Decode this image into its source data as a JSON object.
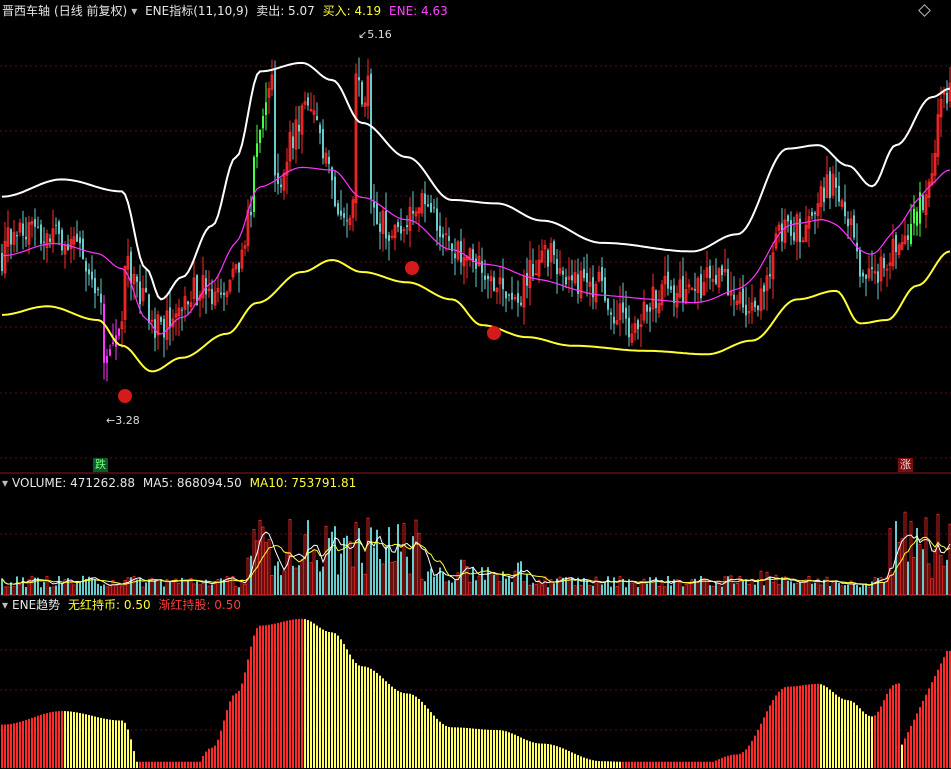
{
  "header_main": {
    "stock": "晋西车轴",
    "period": "(日线 前复权)",
    "indicator": "ENE指标(11,10,9)",
    "sell_label": "卖出: 5.07",
    "buy_label": "买入: 4.19",
    "ene_label": "ENE: 4.63"
  },
  "header_volume": {
    "volume_label": "VOLUME: 471262.88",
    "ma5_label": "MA5: 868094.50",
    "ma10_label": "MA10: 753791.81"
  },
  "header_trend": {
    "name": "ENE趋势",
    "no_red_label": "无红持币: 0.50",
    "red_label": "渐红持股: 0.50"
  },
  "annotations": {
    "high": "5.16",
    "low": "3.28",
    "down_mark": "跌",
    "up_mark": "涨"
  },
  "colors": {
    "upper": "#ffffff",
    "lower": "#ffff33",
    "mid": "#ff33ff",
    "up": "#ff2a2a",
    "down": "#66cccc",
    "green": "#44ff44"
  },
  "chart_data": {
    "type": "candlestick",
    "price_ylim": [
      2.9,
      5.35
    ],
    "ene_upper_anchors": [
      [
        0,
        4.32
      ],
      [
        20,
        4.42
      ],
      [
        40,
        4.35
      ],
      [
        48,
        3.9
      ],
      [
        53,
        3.72
      ],
      [
        60,
        3.85
      ],
      [
        70,
        4.15
      ],
      [
        78,
        4.55
      ],
      [
        86,
        5.05
      ],
      [
        100,
        5.1
      ],
      [
        110,
        5.0
      ],
      [
        120,
        4.75
      ],
      [
        135,
        4.55
      ],
      [
        150,
        4.3
      ],
      [
        165,
        4.28
      ],
      [
        180,
        4.18
      ],
      [
        200,
        4.05
      ],
      [
        230,
        4.0
      ],
      [
        245,
        4.1
      ],
      [
        262,
        4.6
      ],
      [
        272,
        4.62
      ],
      [
        282,
        4.5
      ],
      [
        290,
        4.38
      ],
      [
        298,
        4.62
      ],
      [
        310,
        4.9
      ],
      [
        316,
        4.95
      ]
    ],
    "ene_lower_anchors": [
      [
        0,
        3.63
      ],
      [
        15,
        3.68
      ],
      [
        32,
        3.6
      ],
      [
        40,
        3.45
      ],
      [
        50,
        3.3
      ],
      [
        60,
        3.38
      ],
      [
        75,
        3.52
      ],
      [
        85,
        3.7
      ],
      [
        100,
        3.88
      ],
      [
        110,
        3.95
      ],
      [
        120,
        3.88
      ],
      [
        135,
        3.82
      ],
      [
        150,
        3.72
      ],
      [
        160,
        3.57
      ],
      [
        175,
        3.5
      ],
      [
        190,
        3.45
      ],
      [
        215,
        3.42
      ],
      [
        235,
        3.4
      ],
      [
        250,
        3.48
      ],
      [
        265,
        3.72
      ],
      [
        278,
        3.77
      ],
      [
        286,
        3.58
      ],
      [
        295,
        3.6
      ],
      [
        305,
        3.8
      ],
      [
        316,
        4.0
      ]
    ],
    "volume_ylim": [
      0,
      1600000
    ],
    "trend_ylim": [
      0,
      1
    ]
  }
}
